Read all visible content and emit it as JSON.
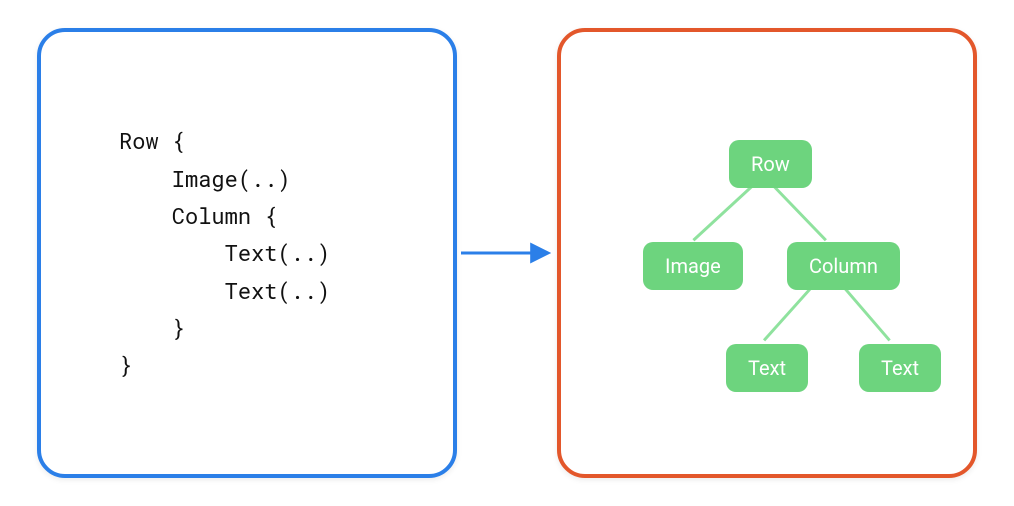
{
  "code": {
    "lines": [
      "Row {",
      "    Image(..)",
      "    Column {",
      "        Text(..)",
      "        Text(..)",
      "    }",
      "}"
    ]
  },
  "tree": {
    "root": "Row",
    "child_image": "Image",
    "child_column": "Column",
    "grandchild_text1": "Text",
    "grandchild_text2": "Text"
  },
  "colors": {
    "code_border": "#2b7fe8",
    "tree_border": "#e3572b",
    "node_fill": "#6dd47e",
    "arrow": "#2b7fe8"
  }
}
